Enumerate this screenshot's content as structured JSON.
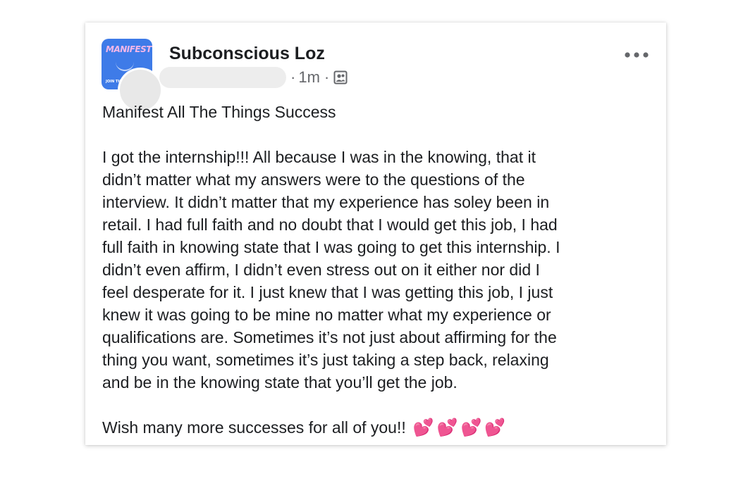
{
  "post": {
    "author": "Subconscious Loz",
    "group_avatar": {
      "logo_text": "MANIFEST",
      "logo_sub": "JOIN THE S"
    },
    "time": "1m",
    "meta_separator": "·",
    "audience_icon": "members-audience-icon",
    "more_icon": "more-options-icon",
    "title": "Manifest All The Things Success",
    "body_lines": [
      "I got the internship!!! All because I was in the knowing, that it",
      "didn’t matter what my answers were to the questions of the",
      "interview. It didn’t matter that my experience has soley been in",
      "retail. I had full faith and no doubt that I would get this job, I had",
      "full faith in knowing state that I was going to get this internship. I",
      "didn’t even affirm, I didn’t even stress out on it either nor did I",
      "feel desperate for it. I just knew that I was getting this job, I just",
      "knew it was going to be mine no matter what my experience or",
      "qualifications are. Sometimes it’s not just about affirming for the",
      "thing you want, sometimes it’s just taking a step back, relaxing",
      "and be in the knowing state that you’ll get the job."
    ],
    "closing": "Wish many more successes for all of you!!",
    "emojis": "💕💕💕💕"
  },
  "colors": {
    "text": "#1c1e21",
    "meta": "#65676b",
    "group_avatar_bg": "#3e7be8",
    "heart_pink": "#ec4fb0"
  }
}
